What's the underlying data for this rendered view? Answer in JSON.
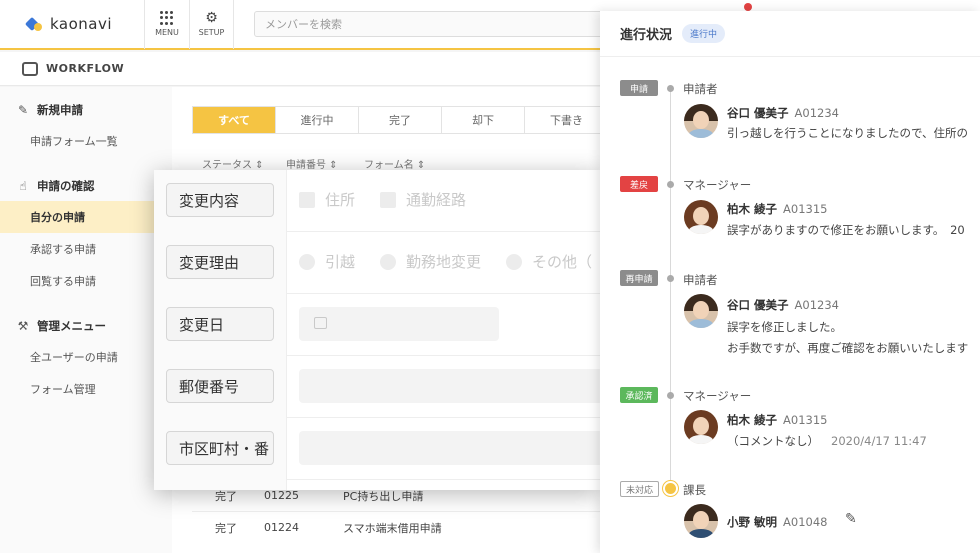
{
  "header": {
    "logo_text": "kaonavi",
    "menu_label": "MENU",
    "setup_label": "SETUP",
    "search_placeholder": "メンバーを検索"
  },
  "workflow": {
    "title": "WORKFLOW"
  },
  "sidebar": {
    "sections": [
      {
        "title": "新規申請",
        "icon": "pencil-note-icon",
        "items": [
          "申請フォーム一覧"
        ]
      },
      {
        "title": "申請の確認",
        "icon": "hand-icon",
        "items": [
          "自分の申請",
          "承認する申請",
          "回覧する申請"
        ]
      },
      {
        "title": "管理メニュー",
        "icon": "wrench-icon",
        "items": [
          "全ユーザーの申請",
          "フォーム管理"
        ]
      }
    ],
    "active_item": "自分の申請"
  },
  "tabs": [
    "すべて",
    "進行中",
    "完了",
    "却下",
    "下書き"
  ],
  "active_tab": "すべて",
  "table": {
    "columns": [
      "ステータス",
      "申請番号",
      "フォーム名"
    ],
    "rows": [
      {
        "status": "完了",
        "number": "01225",
        "form": "PC持ち出し申請"
      },
      {
        "status": "完了",
        "number": "01224",
        "form": "スマホ端末借用申請"
      }
    ]
  },
  "form": {
    "rows": [
      {
        "label": "変更内容",
        "options": [
          "住所",
          "通勤経路"
        ],
        "kind": "checkbox"
      },
      {
        "label": "変更理由",
        "options": [
          "引越",
          "勤務地変更",
          "その他（"
        ],
        "kind": "radio"
      },
      {
        "label": "変更日",
        "kind": "date"
      },
      {
        "label": "郵便番号",
        "kind": "text"
      },
      {
        "label": "市区町村・番",
        "kind": "text"
      }
    ]
  },
  "panel": {
    "title": "進行状況",
    "status_badge": "進行中",
    "entries": [
      {
        "tag": "申請",
        "tag_color": "gray",
        "role": "申請者",
        "name": "谷口 優美子",
        "id": "A01234",
        "messages": [
          "引っ越しを行うことになりましたので、住所の"
        ]
      },
      {
        "tag": "差戻",
        "tag_color": "red",
        "role": "マネージャー",
        "name": "柏木 綾子",
        "id": "A01315",
        "messages": [
          "誤字がありますので修正をお願いします。　20"
        ]
      },
      {
        "tag": "再申請",
        "tag_color": "gray",
        "role": "申請者",
        "name": "谷口 優美子",
        "id": "A01234",
        "messages": [
          "誤字を修正しました。",
          "お手数ですが、再度ご確認をお願いいたします"
        ]
      },
      {
        "tag": "承認済",
        "tag_color": "green",
        "role": "マネージャー",
        "name": "柏木 綾子",
        "id": "A01315",
        "messages": [
          "（コメントなし）"
        ],
        "date": "2020/4/17  11:47"
      },
      {
        "tag": "未対応",
        "tag_color": "outline",
        "role": "課長",
        "name": "小野 敏明",
        "id": "A01048",
        "messages": []
      }
    ]
  },
  "colors": {
    "accent": "#f5c443",
    "active_bg": "#fdefc6",
    "badge_blue": "#4a78c9",
    "tag_red": "#e34343",
    "tag_green": "#5cb85c",
    "tag_gray": "#8c8c8c"
  }
}
